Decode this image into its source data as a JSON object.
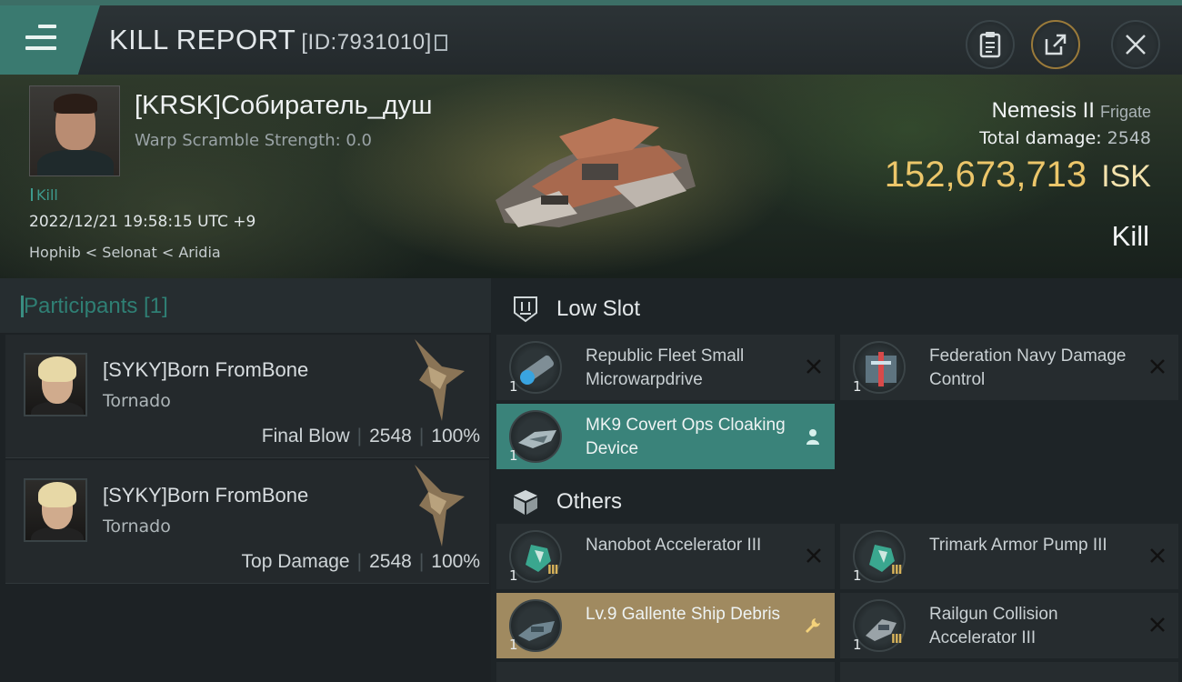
{
  "header": {
    "title": "KILL REPORT",
    "report_id": "[ID:7931010]"
  },
  "victim": {
    "name": "[KRSK]Собиратель_душ",
    "warp_scramble": "Warp Scramble Strength: 0.0",
    "kill_tag": "Kill",
    "datetime": "2022/12/21 19:58:15 UTC +9",
    "location": "Hophib < Selonat < Aridia",
    "ship_name": "Nemesis II",
    "ship_class": "Frigate",
    "total_damage_label": "Total damage:",
    "total_damage": "2548",
    "isk_value": "152,673,713",
    "isk_unit": "ISK",
    "result": "Kill"
  },
  "participants": {
    "header": "Participants [1]",
    "rows": [
      {
        "name": "[SYKY]Born FromBone",
        "ship": "Tornado",
        "role": "Final Blow",
        "damage": "2548",
        "percent": "100%"
      },
      {
        "name": "[SYKY]Born FromBone",
        "ship": "Tornado",
        "role": "Top Damage",
        "damage": "2548",
        "percent": "100%"
      }
    ]
  },
  "sections": {
    "low_slot": "Low Slot",
    "others": "Others"
  },
  "modules": {
    "low": [
      {
        "name": "Republic Fleet Small Microwarpdrive",
        "qty": "1",
        "status": "destroyed"
      },
      {
        "name": "Federation Navy Damage Control",
        "qty": "1",
        "status": "destroyed"
      },
      {
        "name": "MK9 Covert Ops Cloaking Device",
        "qty": "1",
        "status": "dropped"
      }
    ],
    "others": [
      {
        "name": "Nanobot Accelerator III",
        "qty": "1",
        "tier": "III",
        "status": "destroyed"
      },
      {
        "name": "Trimark Armor Pump III",
        "qty": "1",
        "tier": "III",
        "status": "destroyed"
      },
      {
        "name": "Lv.9 Gallente Ship Debris",
        "qty": "1",
        "status": "salvage"
      },
      {
        "name": "Railgun Collision Accelerator III",
        "qty": "1",
        "tier": "III",
        "status": "destroyed"
      }
    ]
  },
  "colors": {
    "accent_teal": "#3a837a",
    "isk_gold": "#ecc66a",
    "debris_gold": "#a08a60"
  }
}
